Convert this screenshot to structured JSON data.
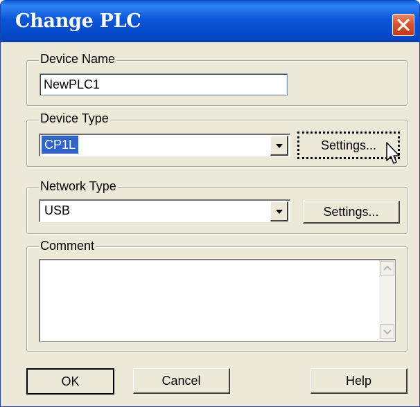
{
  "window": {
    "title": "Change PLC"
  },
  "device_name": {
    "label": "Device Name",
    "value": "NewPLC1"
  },
  "device_type": {
    "label": "Device Type",
    "selected": "CP1L",
    "settings_label": "Settings..."
  },
  "network_type": {
    "label": "Network Type",
    "selected": "USB",
    "settings_label": "Settings..."
  },
  "comment": {
    "label": "Comment",
    "value": ""
  },
  "buttons": {
    "ok": "OK",
    "cancel": "Cancel",
    "help": "Help"
  },
  "icons": {
    "close": "close-icon",
    "dropdown": "chevron-down-icon",
    "scroll_up": "scroll-up-icon",
    "scroll_down": "scroll-down-icon",
    "cursor": "mouse-pointer-icon"
  },
  "colors": {
    "titlebar": "#0b56d8",
    "close_button": "#d7542e",
    "selection": "#3164c5",
    "dialog_bg": "#ece9d8"
  }
}
